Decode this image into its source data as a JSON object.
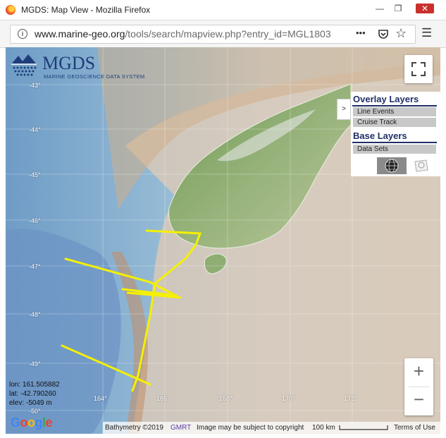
{
  "window": {
    "title": "MGDS: Map View - Mozilla Firefox",
    "minimize": "—",
    "restore": "❐",
    "close": "✕"
  },
  "browser": {
    "url_domain": "www.marine-geo.org",
    "url_path": "/tools/search/mapview.php?entry_id=MGL1803",
    "more_icon": "•••",
    "pocket_icon": "pocket-icon",
    "bookmark_icon": "☆",
    "menu_icon": "☰"
  },
  "logo": {
    "name": "MGDS",
    "subtitle": "MARINE GEOSCIENCE DATA SYSTEM"
  },
  "layers_panel": {
    "toggle_label": ">",
    "overlay_heading": "Overlay Layers",
    "overlay_items": [
      "Line Events",
      "Cruise Track"
    ],
    "base_heading": "Base Layers",
    "base_items": [
      "Data Sets"
    ]
  },
  "map": {
    "lat_ticks": [
      "-43°",
      "-44°",
      "-45°",
      "-46°",
      "-47°",
      "-48°",
      "-49°",
      "-50°"
    ],
    "lon_ticks": [
      "164°",
      "166°",
      "168°",
      "170°",
      "172°"
    ],
    "track_color": "#f5f000"
  },
  "cursor_readout": {
    "lon": "lon: 161.505882",
    "lat": "lat: -42.790260",
    "elev": "elev: -5049 m"
  },
  "zoom": {
    "in": "+",
    "out": "−"
  },
  "attribution": {
    "bathymetry": "Bathymetry ©2019",
    "gmrt": "GMRT",
    "copyright": "Image may be subject to copyright",
    "scale": "100 km",
    "terms": "Terms of Use"
  },
  "google": "Google"
}
